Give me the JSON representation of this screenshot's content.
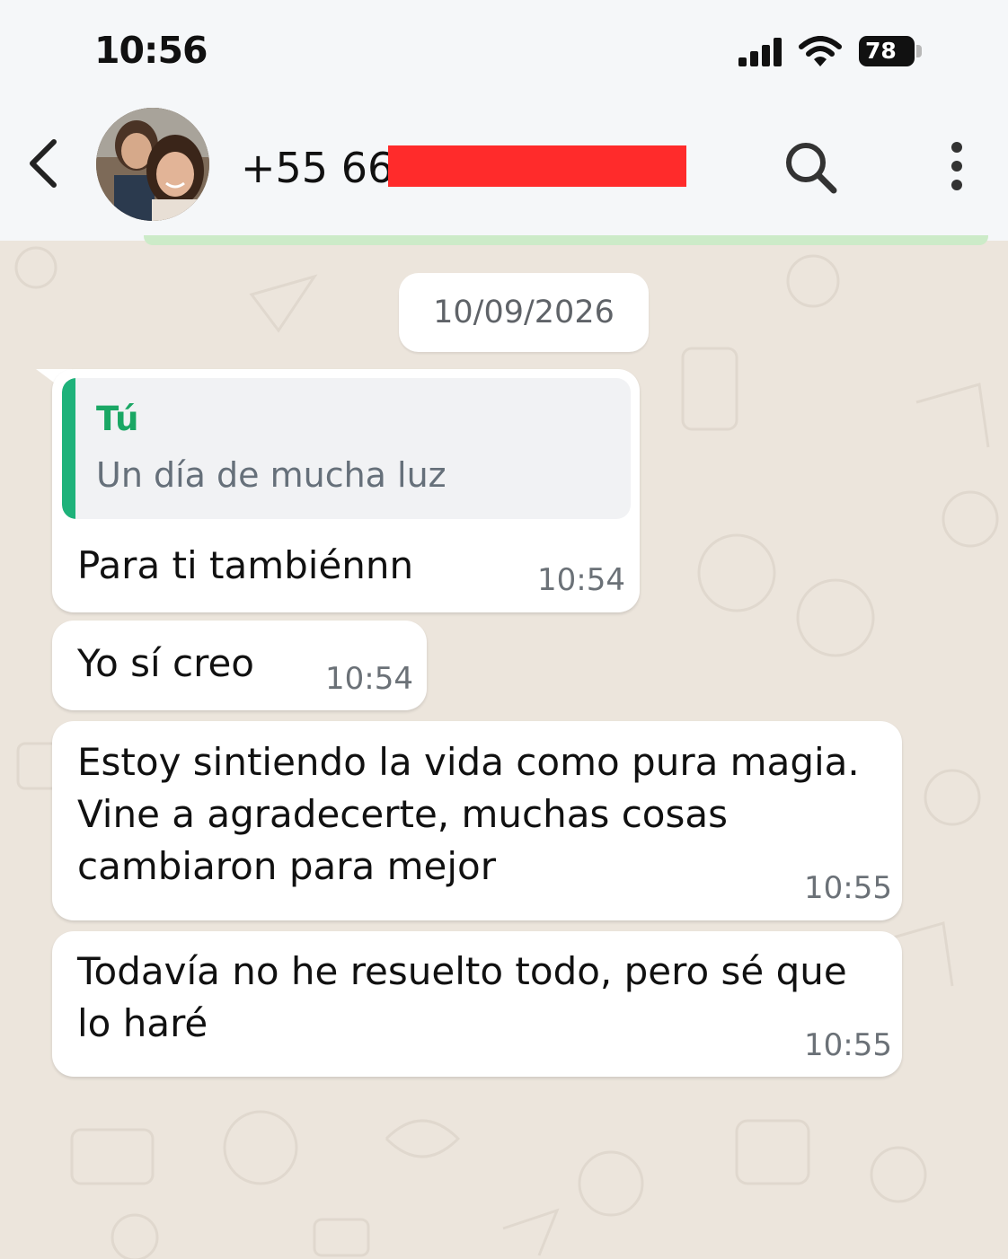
{
  "status_bar": {
    "time": "10:56",
    "battery": "78"
  },
  "header": {
    "contact_visible_number": "+55 66"
  },
  "date_separator": "10/09/2026",
  "messages": [
    {
      "quoted": {
        "author": "Tú",
        "text": "Un día de mucha luz"
      },
      "lines": [
        "Para ti tambiénnn"
      ],
      "time": "10:54"
    },
    {
      "lines": [
        "Yo sí creo"
      ],
      "time": "10:54"
    },
    {
      "lines": [
        "Estoy sintiendo la vida como pura magia.",
        "Vine a agradecerte, muchas cosas",
        "cambiaron para mejor"
      ],
      "time": "10:55"
    },
    {
      "lines": [
        "Todavía no he resuelto todo, pero sé que",
        "lo haré"
      ],
      "time": "10:55"
    }
  ],
  "colors": {
    "chat_background": "#ece5dc",
    "bubble": "#ffffff",
    "quote_accent": "#1eb27a",
    "redaction": "#ff2b2b",
    "header": "#f5f7f9"
  },
  "icons": [
    "back-arrow-icon",
    "search-icon",
    "more-options-icon",
    "signal-icon",
    "wifi-icon",
    "battery-icon"
  ]
}
